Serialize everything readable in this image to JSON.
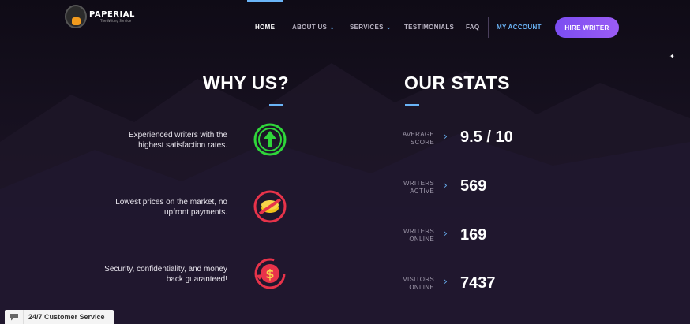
{
  "header": {
    "logo_name": "PAPERIAL",
    "logo_tag": "The Writing Service",
    "nav": {
      "home": "HOME",
      "about": "ABOUT US",
      "services": "SERVICES",
      "testimonials": "TESTIMONIALS",
      "faq": "FAQ",
      "account": "MY ACCOUNT"
    },
    "hire_label": "HIRE WRITER"
  },
  "why_us": {
    "title": "WHY US?",
    "items": [
      {
        "text": "Experienced writers with the highest satisfaction rates.",
        "icon": "arrow-up-icon",
        "color": "#2fd63a"
      },
      {
        "text": "Lowest prices on the market, no upfront payments.",
        "icon": "no-money-icon",
        "color": "#e8334a"
      },
      {
        "text": "Security, confidentiality, and money back guaranteed!",
        "icon": "money-back-icon",
        "color": "#e8334a"
      }
    ]
  },
  "stats": {
    "title": "OUR STATS",
    "items": [
      {
        "label_1": "AVERAGE",
        "label_2": "SCORE",
        "value": "9.5 / 10"
      },
      {
        "label_1": "WRITERS",
        "label_2": "ACTIVE",
        "value": "569"
      },
      {
        "label_1": "WRITERS",
        "label_2": "ONLINE",
        "value": "169"
      },
      {
        "label_1": "VISITORS",
        "label_2": "ONLINE",
        "value": "7437"
      }
    ]
  },
  "support": {
    "label": "24/7 Customer Service",
    "icon": "chat-bubble-icon"
  },
  "colors": {
    "accent_blue": "#6ab4f7",
    "button_purple": "#8a55f3",
    "background": "#120d1a"
  }
}
